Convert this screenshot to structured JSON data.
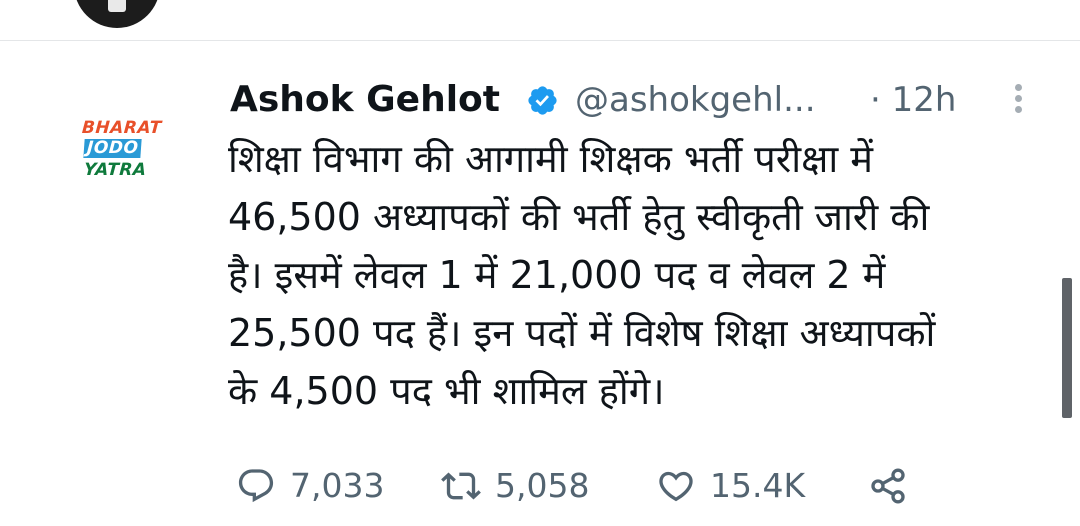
{
  "tweet": {
    "avatar_logo": [
      "BHARAT",
      "JODO",
      "YATRA"
    ],
    "author_name": "Ashok Gehlot",
    "handle": "@ashokgehl...",
    "time": "· 12h",
    "text_lines": [
      "शिक्षा विभाग की आगामी शिक्षक भर्ती परीक्षा में",
      "46,500 अध्यापकों की भर्ती हेतु स्वीकृती जारी की",
      "है। इसमें लेवल 1 में 21,000 पद व लेवल 2 में",
      "25,500 पद हैं। इन पदों में विशेष शिक्षा अध्यापकों",
      "के 4,500 पद भी शामिल होंगे।"
    ],
    "actions": {
      "reply_count": "7,033",
      "retweet_count": "5,058",
      "like_count": "15.4K"
    }
  },
  "colors": {
    "verified_blue": "#1d9bf0",
    "secondary_text": "#536471",
    "icon_gray": "#536471"
  },
  "icons": [
    "verified-badge-icon",
    "more-icon",
    "reply-icon",
    "retweet-icon",
    "like-icon",
    "share-icon"
  ]
}
